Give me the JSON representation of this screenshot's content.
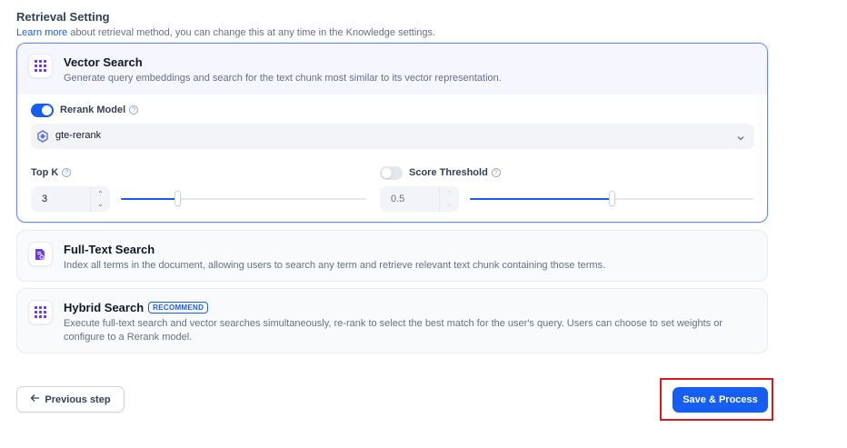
{
  "retrieval": {
    "title": "Retrieval Setting",
    "learn_more": "Learn more",
    "subtitle": " about retrieval method, you can change this at any time in the Knowledge settings."
  },
  "vector_search": {
    "title": "Vector Search",
    "description": "Generate query embeddings and search for the text chunk most similar to its vector representation.",
    "rerank_label": "Rerank Model",
    "rerank_enabled": true,
    "rerank_model": "gte-rerank",
    "top_k_label": "Top K",
    "top_k_value": "3",
    "top_k_slider_fraction": 0.23,
    "score_threshold_label": "Score Threshold",
    "score_threshold_enabled": false,
    "score_threshold_value": "0.5",
    "score_threshold_slider_fraction": 0.5
  },
  "full_text_search": {
    "title": "Full-Text Search",
    "description": "Index all terms in the document, allowing users to search any term and retrieve relevant text chunk containing those terms."
  },
  "hybrid_search": {
    "title": "Hybrid Search",
    "badge": "RECOMMEND",
    "description": "Execute full-text search and vector searches simultaneously, re-rank to select the best match for the user's query. Users can choose to set weights or configure to a Rerank model."
  },
  "footer": {
    "previous_label": "Previous step",
    "save_label": "Save & Process"
  },
  "colors": {
    "accent": "#155eef",
    "highlight": "#e0161b",
    "icon_purple": "#6938ef"
  },
  "icons": {
    "vector": "grid-dots-icon",
    "full_text": "document-search-icon",
    "hybrid": "grid-dots-icon",
    "back": "arrow-left-icon",
    "dropdown": "chevron-down-icon"
  }
}
